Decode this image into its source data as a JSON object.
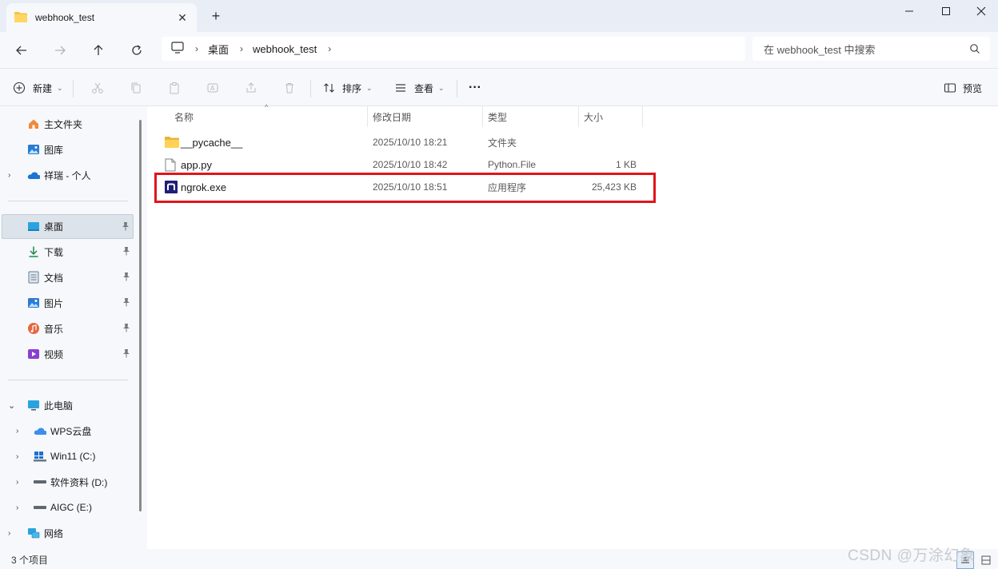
{
  "window": {
    "tab_title": "webhook_test",
    "new_tab_symbol": "+",
    "close_symbol": "✕"
  },
  "address": {
    "breadcrumbs": [
      "桌面",
      "webhook_test"
    ],
    "search_placeholder": "在 webhook_test 中搜索"
  },
  "toolbar": {
    "new_label": "新建",
    "sort_label": "排序",
    "view_label": "查看",
    "more_label": "···",
    "preview_label": "预览"
  },
  "sidebar": {
    "home": "主文件夹",
    "gallery": "图库",
    "onedrive": "祥瑞 - 个人",
    "quick_access": [
      "桌面",
      "下载",
      "文档",
      "图片",
      "音乐",
      "视频"
    ],
    "this_pc": "此电脑",
    "drives": [
      "WPS云盘",
      "Win11 (C:)",
      "软件资料 (D:)",
      "AIGC (E:)"
    ],
    "network": "网络"
  },
  "columns": {
    "name": "名称",
    "modified": "修改日期",
    "type": "类型",
    "size": "大小"
  },
  "files": [
    {
      "name": "__pycache__",
      "modified": "2025/10/10 18:21",
      "type": "文件夹",
      "size": ""
    },
    {
      "name": "app.py",
      "modified": "2025/10/10 18:42",
      "type": "Python.File",
      "size": "1 KB"
    },
    {
      "name": "ngrok.exe",
      "modified": "2025/10/10 18:51",
      "type": "应用程序",
      "size": "25,423 KB"
    }
  ],
  "status": {
    "item_count": "3 个项目"
  },
  "watermark": "CSDN @万涂幻象",
  "colors": {
    "highlight": "#e0151b",
    "folder": "#f5c542",
    "accent": "#0067c0"
  }
}
